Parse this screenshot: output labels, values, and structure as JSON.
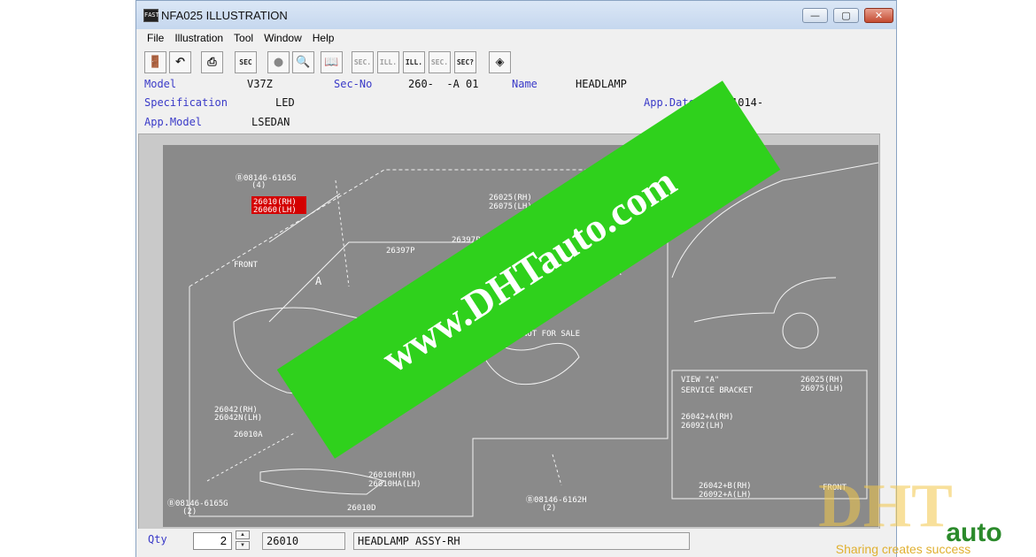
{
  "window": {
    "title": "NFA025 ILLUSTRATION",
    "app_icon_text": "FAST",
    "controls": {
      "minimize": "—",
      "maximize": "▢",
      "close": "✕"
    }
  },
  "menu": [
    "File",
    "Illustration",
    "Tool",
    "Window",
    "Help"
  ],
  "toolbar": [
    {
      "name": "exit-tool",
      "text": "🚪",
      "enabled": true
    },
    {
      "name": "undo-tool",
      "text": "↶",
      "enabled": true
    },
    {
      "name": "print-tool",
      "text": "⎙",
      "enabled": true
    },
    {
      "name": "sec-tool",
      "text": "SEC",
      "enabled": true
    },
    {
      "name": "circle-tool",
      "text": "●",
      "enabled": true
    },
    {
      "name": "zoom-tool",
      "text": "🔍",
      "enabled": true
    },
    {
      "name": "book-tool",
      "text": "📖",
      "enabled": true
    },
    {
      "name": "sec-prev-tool",
      "text": "SEC.",
      "enabled": false
    },
    {
      "name": "ill-prev-tool",
      "text": "ILL.",
      "enabled": false
    },
    {
      "name": "ill-next-tool",
      "text": "ILL.",
      "enabled": true
    },
    {
      "name": "sec-next-tool",
      "text": "SEC.",
      "enabled": false
    },
    {
      "name": "sec-query-tool",
      "text": "SEC?",
      "enabled": true
    },
    {
      "name": "tag-tool",
      "text": "◈",
      "enabled": true
    }
  ],
  "info": {
    "model_label": "Model",
    "model_value": "V37Z",
    "secno_label": "Sec-No",
    "secno_value": "260-  -A 01",
    "name_label": "Name",
    "name_value": "HEADLAMP",
    "spec_label": "Specification",
    "spec_value": "LED",
    "appdate_label": "App.Date",
    "appdate_value": "1014-",
    "appmodel_label": "App.Model",
    "appmodel_value": "LSEDAN"
  },
  "illustration": {
    "labels": [
      "Ⓑ08146-6165G",
      "(4)",
      "26010(RH)",
      "26060(LH)",
      "FRONT",
      "A",
      "26397P",
      "26397P",
      "26025(RH)",
      "26075(LH)",
      "29MA",
      "NOT FOR SALE",
      "26042(RH)",
      "26042N(LH)",
      "26010A",
      "Ⓑ08146-6165G",
      "(2)",
      "26010H(RH)",
      "26010HA(LH)",
      "26010D",
      "Ⓑ08146-6162H",
      "(2)",
      "VIEW \"A\"",
      "SERVICE BRACKET",
      "26025(RH)",
      "26075(LH)",
      "26042+A(RH)",
      "26092(LH)",
      "26042+B(RH)",
      "26092+A(LH)",
      "FRONT"
    ]
  },
  "status": {
    "qty_label": "Qty",
    "qty_value": "2",
    "part_number": "26010",
    "part_name": "HEADLAMP ASSY-RH"
  },
  "watermark": {
    "banner_text": "www.DHTauto.com",
    "logo_text": "DHT",
    "logo_auto": "auto",
    "slogan": "Sharing creates success"
  },
  "colors": {
    "label_blue": "#3a3ac8",
    "banner_green": "#2fd11c",
    "highlight_red": "#d40000"
  }
}
